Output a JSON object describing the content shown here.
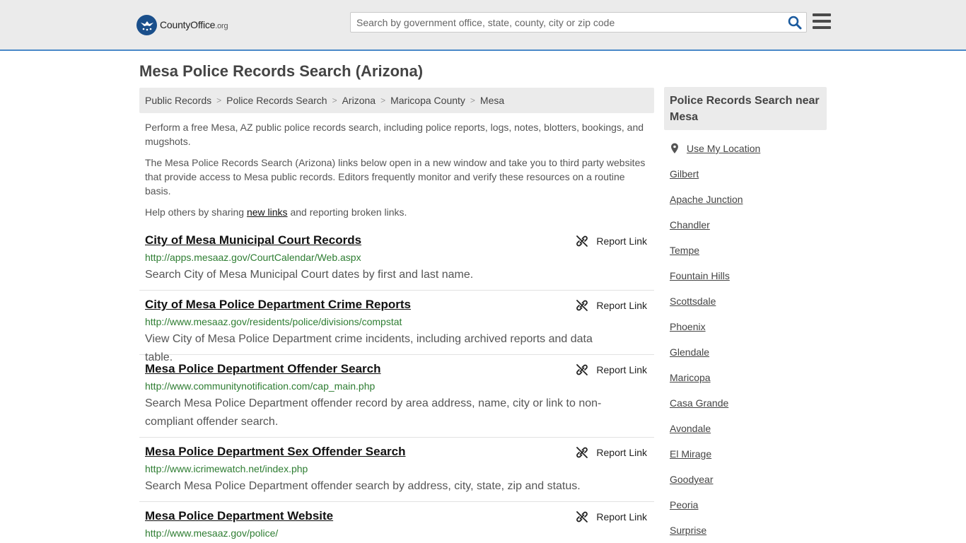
{
  "header": {
    "logo_text": "CountyOffice",
    "logo_suffix": ".org",
    "search_placeholder": "Search by government office, state, county, city or zip code"
  },
  "page_title": "Mesa Police Records Search (Arizona)",
  "breadcrumb": [
    "Public Records",
    "Police Records Search",
    "Arizona",
    "Maricopa County",
    "Mesa"
  ],
  "intro": {
    "p1": "Perform a free Mesa, AZ public police records search, including police reports, logs, notes, blotters, bookings, and mugshots.",
    "p2": "The Mesa Police Records Search (Arizona) links below open in a new window and take you to third party websites that provide access to Mesa public records. Editors frequently monitor and verify these resources on a routine basis.",
    "p3_before": "Help others by sharing ",
    "p3_link": "new links",
    "p3_after": " and reporting broken links."
  },
  "report_label": "Report Link",
  "results": [
    {
      "title": "City of Mesa Municipal Court Records",
      "url": "http://apps.mesaaz.gov/CourtCalendar/Web.aspx",
      "desc": "Search City of Mesa Municipal Court dates by first and last name."
    },
    {
      "title": "City of Mesa Police Department Crime Reports",
      "url": "http://www.mesaaz.gov/residents/police/divisions/compstat",
      "desc": "View City of Mesa Police Department crime incidents, including archived reports and data table."
    },
    {
      "title": "Mesa Police Department Offender Search",
      "url": "http://www.communitynotification.com/cap_main.php",
      "desc": "Search Mesa Police Department offender record by area address, name, city or link to non-compliant offender search."
    },
    {
      "title": "Mesa Police Department Sex Offender Search",
      "url": "http://www.icrimewatch.net/index.php",
      "desc": "Search Mesa Police Department offender search by address, city, state, zip and status."
    },
    {
      "title": "Mesa Police Department Website",
      "url": "http://www.mesaaz.gov/police/",
      "desc": ""
    }
  ],
  "sidebar": {
    "heading": "Police Records Search near Mesa",
    "use_location": "Use My Location",
    "cities": [
      "Gilbert",
      "Apache Junction",
      "Chandler",
      "Tempe",
      "Fountain Hills",
      "Scottsdale",
      "Phoenix",
      "Glendale",
      "Maricopa",
      "Casa Grande",
      "Avondale",
      "El Mirage",
      "Goodyear",
      "Peoria",
      "Surprise"
    ]
  },
  "colors": {
    "accent": "#4a89c8",
    "url_green": "#2e7d32",
    "search_icon": "#1a5a9e"
  }
}
